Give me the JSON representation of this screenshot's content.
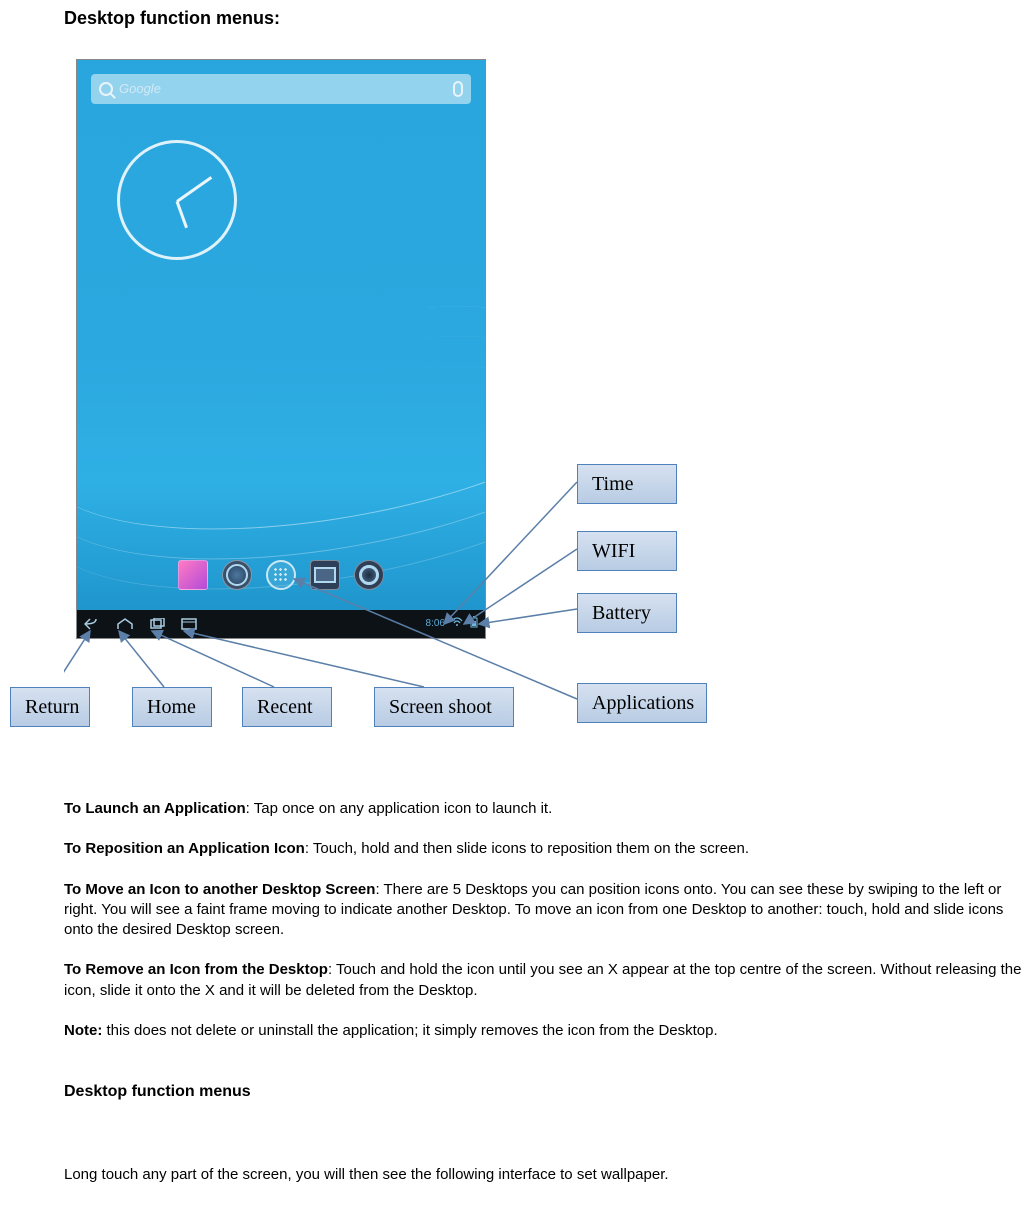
{
  "title": "Desktop function menus:",
  "searchbar_placeholder": "Google",
  "clock_time": "8:06",
  "callouts": {
    "time": "Time",
    "wifi": "WIFI",
    "battery": "Battery",
    "applications": "Applications",
    "return": "Return",
    "home": "Home",
    "recent": "Recent",
    "screenshoot": "Screen shoot"
  },
  "instructions": {
    "launch_b": "To Launch an Application",
    "launch_t": ": Tap once on any application icon to launch it.",
    "reposition_b": "To Reposition an Application Icon",
    "reposition_t": ": Touch, hold and then slide icons to reposition them on the screen.",
    "move_b": "To Move an Icon to another Desktop Screen",
    "move_t": ": There are 5 Desktops you can position icons onto. You can see these by swiping to the left or right. You will see a faint frame moving to indicate another Desktop. To move an icon from one Desktop to another: touch, hold and slide icons onto the desired Desktop screen.",
    "remove_b": "To Remove an Icon from the Desktop",
    "remove_t": ": Touch and hold the icon until you see an X appear at the top centre of the screen. Without releasing the icon, slide it onto the X and it will be deleted from the Desktop.",
    "note_b": "Note:",
    "note_t": " this does not delete or uninstall the application; it simply removes the icon from the Desktop."
  },
  "subheading": "Desktop function menus",
  "trailing": "Long touch any part of the screen, you will then see the following interface to set wallpaper."
}
